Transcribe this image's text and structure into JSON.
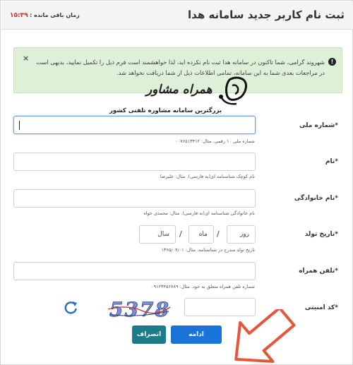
{
  "header": {
    "title": "ثبت نام کاربر جدید سامانه هدا",
    "timer_label": "زمان باقی مانده :",
    "timer_value": "۱۵:۳۹"
  },
  "alert": {
    "icon": "exclamation-icon",
    "close_symbol": "×",
    "text": "شهروند گرامی، شما تاکنون در سامانه هدا ثبت نام نکرده اید، لذا خواهشمند است فرم ذیل را تکمیل نمایید، بدیهی است در مراجعات بعدی شما به این سامانه، تمامی اطلاعات ذیل از شما دریافت نخواهد شد."
  },
  "watermark": {
    "brand": "همراه مشاور",
    "subtitle": "بزرگترین سامانه مشاوره تلفنی کشور"
  },
  "form": {
    "national_id": {
      "label": "شماره ملی",
      "value": "",
      "help": "شماره ملی ۱۰ رقمی. مثال: ۰۰۷۶۵۱۳۴۱۲"
    },
    "first_name": {
      "label": "نام",
      "value": "",
      "help": "نام کوچک شناسنامه ای(به فارسی). مثال: علیرضا"
    },
    "last_name": {
      "label": "نام خانوادگی",
      "value": "",
      "help": "نام خانوادگی شناسنامه ای(به فارسی). مثال: محمدی خواه"
    },
    "birth_date": {
      "label": "تاریخ تولد",
      "day_placeholder": "روز",
      "month_placeholder": "ماه",
      "year_placeholder": "سال",
      "separator": "/",
      "help": "تاریخ تولد مندرج در شناسنامه. مثال: ۱۳۶۵/۰۴/۰۱"
    },
    "mobile": {
      "label": "تلفن همراه",
      "value": "",
      "help": "شماره تلفن همراه متعلق به خود. مثال: ۰۹۱۲۳۴۵۶۷۸۹"
    },
    "captcha": {
      "label": "کد امنیتی",
      "value": "",
      "image_text": "5378",
      "refresh_icon": "refresh-icon"
    },
    "required_mark": "*"
  },
  "buttons": {
    "continue": "ادامه",
    "cancel": "انصراف"
  },
  "colors": {
    "alert_bg": "#dff0d8",
    "primary": "#1a73d9",
    "secondary": "#1c7c8c",
    "timer": "#c9302c",
    "arrow": "#e8563a"
  }
}
